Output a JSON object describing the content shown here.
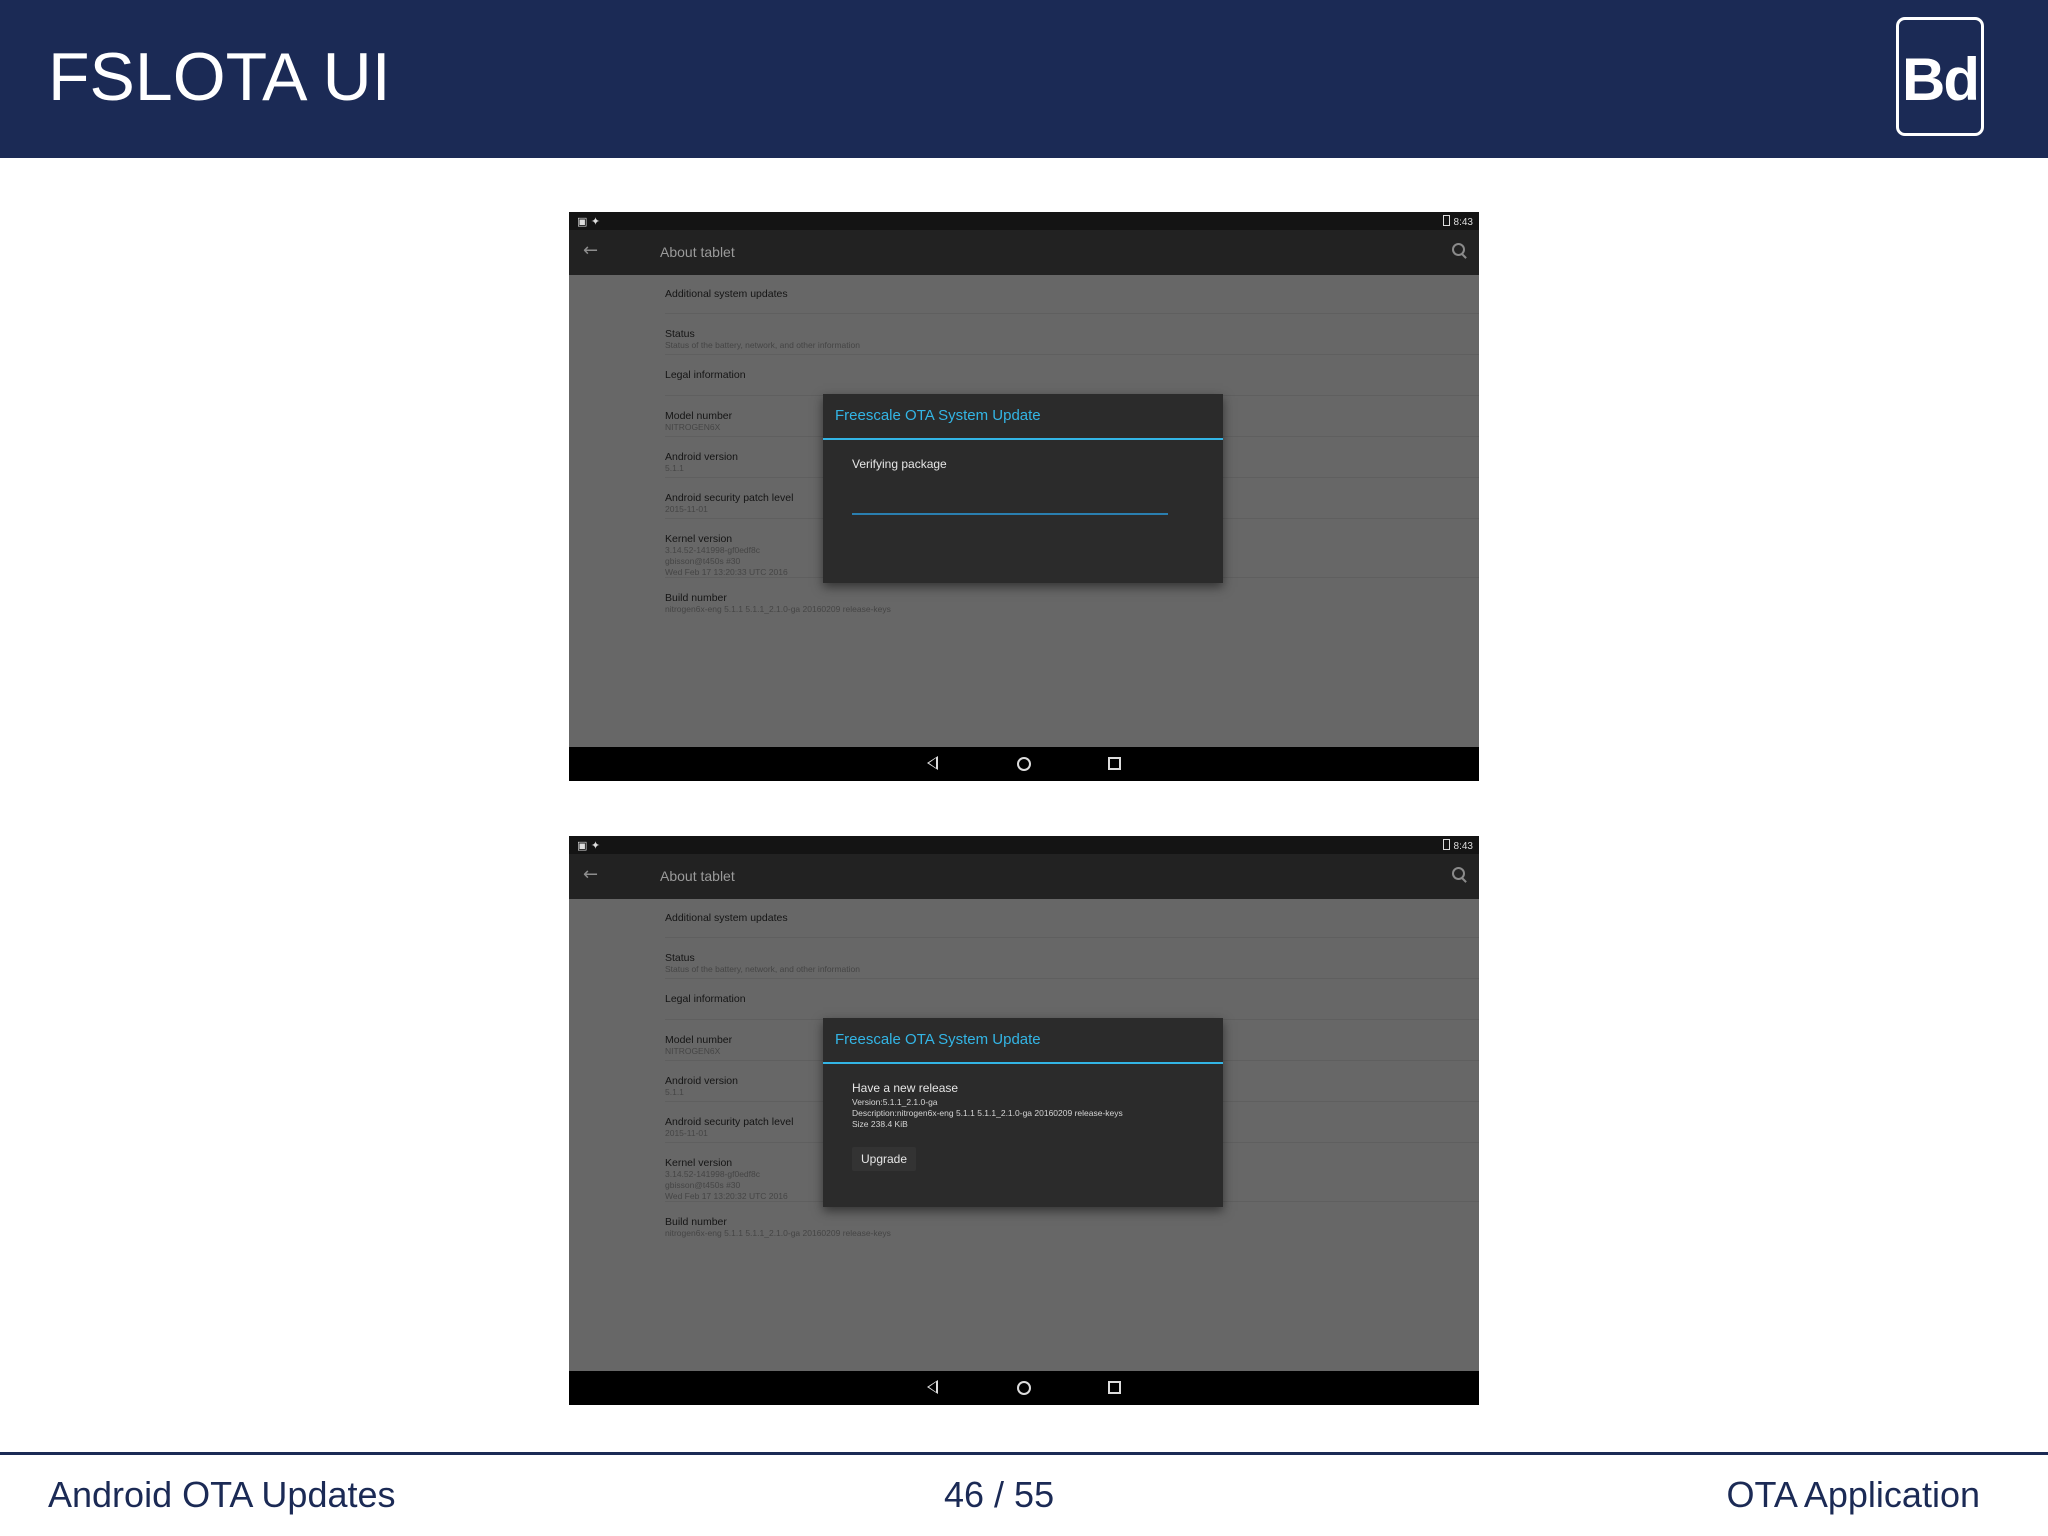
{
  "slide": {
    "title": "FSLOTA UI",
    "logo_text": "Bd"
  },
  "screens": [
    {
      "status_time": "8:43",
      "appbar_title": "About tablet",
      "prefs": [
        {
          "title": "Additional system updates",
          "summary": ""
        },
        {
          "title": "Status",
          "summary": "Status of the battery, network, and other information"
        },
        {
          "title": "Legal information",
          "summary": ""
        },
        {
          "title": "Model number",
          "summary": "NITROGEN6X"
        },
        {
          "title": "Android version",
          "summary": "5.1.1"
        },
        {
          "title": "Android security patch level",
          "summary": "2015-11-01"
        },
        {
          "title": "Kernel version",
          "summary": "3.14.52-141998-gf0edf8c\ngbisson@t450s #30\nWed Feb 17 13:20:33 UTC 2016"
        },
        {
          "title": "Build number",
          "summary": "nitrogen6x-eng 5.1.1 5.1.1_2.1.0-ga 20160209 release-keys"
        }
      ],
      "dialog": {
        "title": "Freescale OTA System Update",
        "message": "Verifying package",
        "progress": 1.0
      }
    },
    {
      "status_time": "8:43",
      "appbar_title": "About tablet",
      "prefs": [
        {
          "title": "Additional system updates",
          "summary": ""
        },
        {
          "title": "Status",
          "summary": "Status of the battery, network, and other information"
        },
        {
          "title": "Legal information",
          "summary": ""
        },
        {
          "title": "Model number",
          "summary": "NITROGEN6X"
        },
        {
          "title": "Android version",
          "summary": "5.1.1"
        },
        {
          "title": "Android security patch level",
          "summary": "2015-11-01"
        },
        {
          "title": "Kernel version",
          "summary": "3.14.52-141998-gf0edf8c\ngbisson@t450s #30\nWed Feb 17 13:20:32 UTC 2016"
        },
        {
          "title": "Build number",
          "summary": "nitrogen6x-eng 5.1.1 5.1.1_2.1.0-ga 20160209 release-keys"
        }
      ],
      "dialog": {
        "title": "Freescale OTA System Update",
        "message": "Have a new release",
        "details": "Version:5.1.1_2.1.0-ga\nDescription:nitrogen6x-eng 5.1.1 5.1.1_2.1.0-ga 20160209 release-keys\nSize 238.4 KiB",
        "button_label": "Upgrade"
      }
    }
  ],
  "icons": {
    "back": "arrow-left-icon",
    "search": "search-icon",
    "nav_back": "triangle-back-icon",
    "nav_home": "circle-home-icon",
    "nav_recent": "square-recents-icon"
  },
  "colors": {
    "header_bg": "#1b2a55",
    "dialog_accent": "#33b5e5"
  },
  "footer": {
    "left": "Android OTA Updates",
    "center": "46 / 55",
    "right": "OTA Application"
  }
}
